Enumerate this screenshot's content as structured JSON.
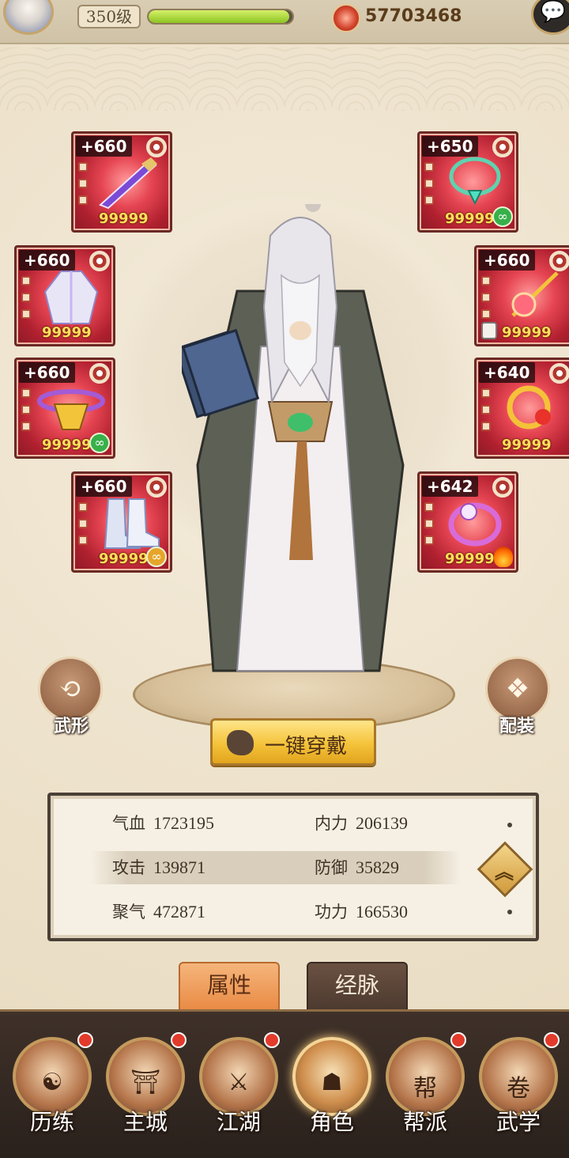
{
  "topbar": {
    "level": "350级",
    "exp_progress": 0.98,
    "currency_icon": "red-gem-icon",
    "currency_value": "57703468",
    "chat_icon": "chat-bubble-icon"
  },
  "equipment": {
    "left": [
      {
        "level": "+660",
        "count": "99999",
        "item": "sword",
        "corner": "none"
      },
      {
        "level": "+660",
        "count": "99999",
        "item": "robe",
        "corner": "none"
      },
      {
        "level": "+660",
        "count": "99999",
        "item": "belt",
        "corner": "link-green"
      },
      {
        "level": "+660",
        "count": "99999",
        "item": "boots",
        "corner": "link-gold"
      }
    ],
    "right": [
      {
        "level": "+650",
        "count": "99999",
        "item": "necklace",
        "corner": "link-green"
      },
      {
        "level": "+660",
        "count": "99999",
        "item": "hairpin",
        "corner": "lock"
      },
      {
        "level": "+640",
        "count": "99999",
        "item": "pendant",
        "corner": "none"
      },
      {
        "level": "+642",
        "count": "99999",
        "item": "ring",
        "corner": "fire"
      }
    ]
  },
  "side_buttons": {
    "left_label": "武形",
    "right_label": "配装"
  },
  "equip_all_label": "一键穿戴",
  "stats": [
    {
      "k": "气血",
      "v": "1723195"
    },
    {
      "k": "内力",
      "v": "206139"
    },
    {
      "k": "攻击",
      "v": "139871"
    },
    {
      "k": "防御",
      "v": "35829"
    },
    {
      "k": "聚气",
      "v": "472871"
    },
    {
      "k": "功力",
      "v": "166530"
    }
  ],
  "tabs": {
    "active": "属性",
    "inactive": "经脉"
  },
  "nav": [
    {
      "label": "历练",
      "glyph": "☯",
      "badge": true,
      "active": false
    },
    {
      "label": "主城",
      "glyph": "⛩",
      "badge": true,
      "active": false
    },
    {
      "label": "江湖",
      "glyph": "⚔",
      "badge": true,
      "active": false
    },
    {
      "label": "角色",
      "glyph": "☗",
      "badge": false,
      "active": true
    },
    {
      "label": "帮派",
      "glyph": "帮",
      "badge": true,
      "active": false
    },
    {
      "label": "武学",
      "glyph": "卷",
      "badge": true,
      "active": false
    }
  ]
}
